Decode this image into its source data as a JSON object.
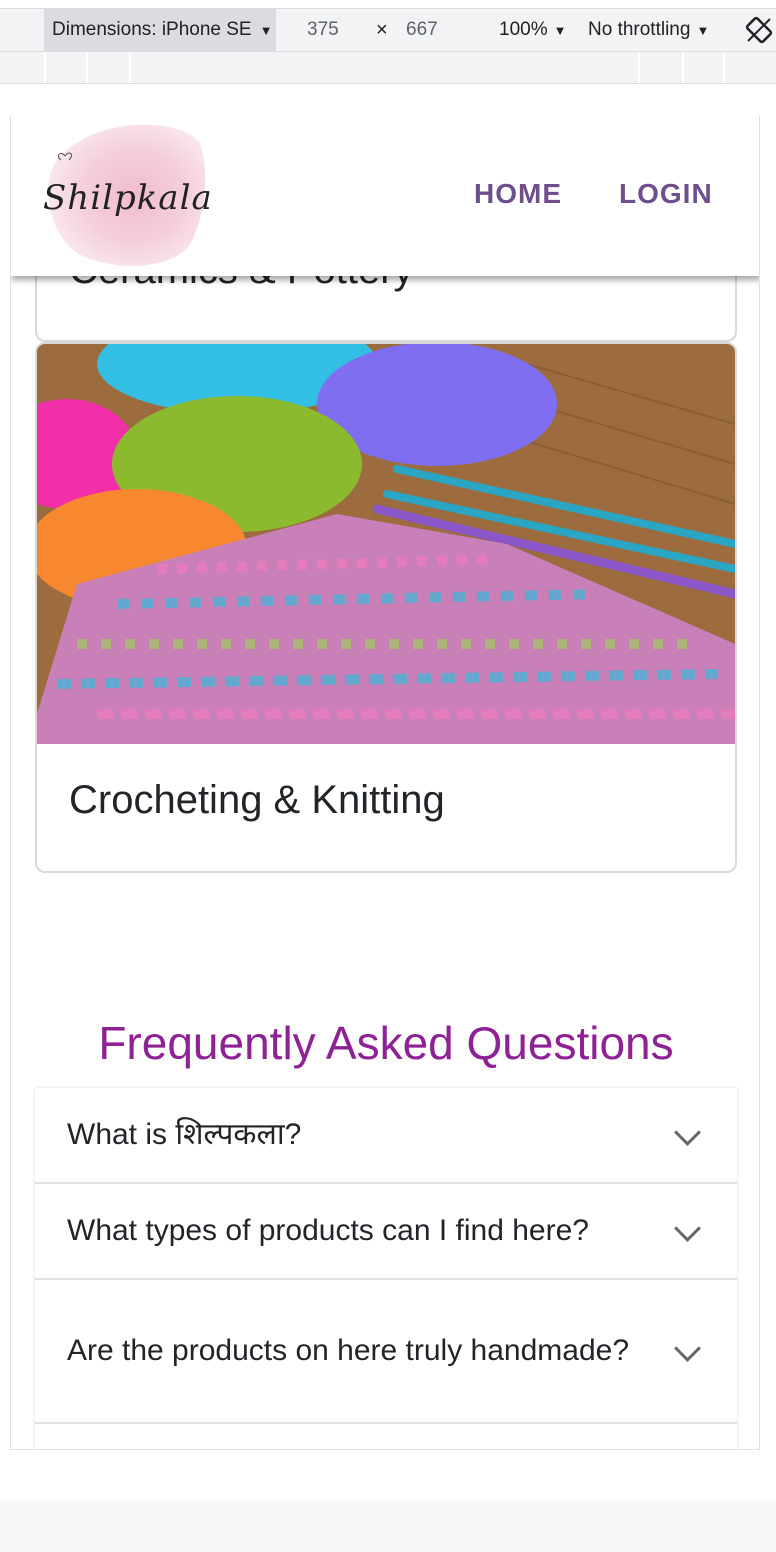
{
  "devtools": {
    "dimensions_label": "Dimensions: iPhone SE",
    "width": "375",
    "times": "×",
    "height": "667",
    "zoom": "100%",
    "throttling": "No throttling",
    "rotate_icon": "rotate-icon"
  },
  "navbar": {
    "logo_text": "Shilpkala",
    "links": [
      "HOME",
      "LOGIN"
    ],
    "link_color": "#6f4e8c"
  },
  "cards": {
    "previous_title": "Ceramics & Pottery",
    "main_title": "Crocheting & Knitting"
  },
  "faq": {
    "heading": "Frequently Asked Questions",
    "heading_color": "#8e2194",
    "items": [
      "What is शिल्पकला?",
      "What types of products can I find here?",
      "Are the products on here truly handmade?"
    ]
  }
}
